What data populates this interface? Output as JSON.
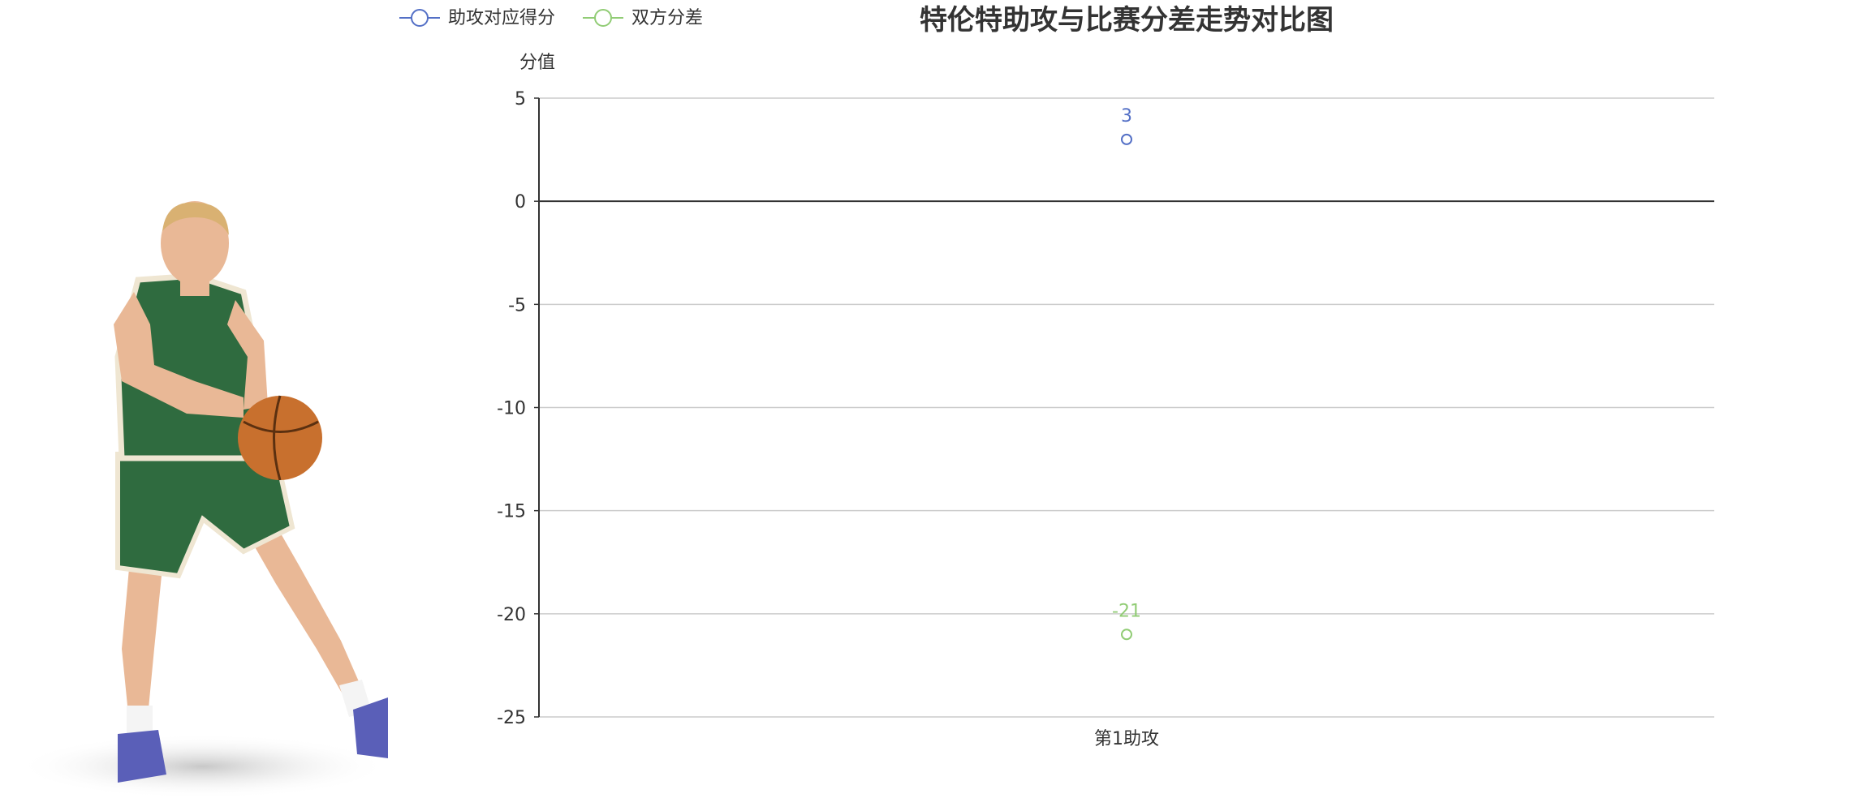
{
  "chart_data": {
    "type": "scatter",
    "title": "特伦特助攻与比赛分差走势对比图",
    "ylabel": "分值",
    "xlabel": "",
    "categories": [
      "第1助攻"
    ],
    "ylim": [
      -25,
      5
    ],
    "yticks": [
      5,
      0,
      -5,
      -10,
      -15,
      -20,
      -25
    ],
    "grid": true,
    "legend_position": "top-left",
    "series": [
      {
        "name": "助攻对应得分",
        "values": [
          3
        ],
        "color": "#5470c6"
      },
      {
        "name": "双方分差",
        "values": [
          -21
        ],
        "color": "#91cc75"
      }
    ]
  },
  "colors": {
    "title": "#333333",
    "axis": "#333333",
    "grid": "#cccccc",
    "jersey": "#2f6b3f",
    "trim": "#efe6d2",
    "skin": "#e9b896",
    "ball": "#c8702e",
    "shoe": "#5a5fb8"
  },
  "image": {
    "name": "basketball-player-photo"
  }
}
